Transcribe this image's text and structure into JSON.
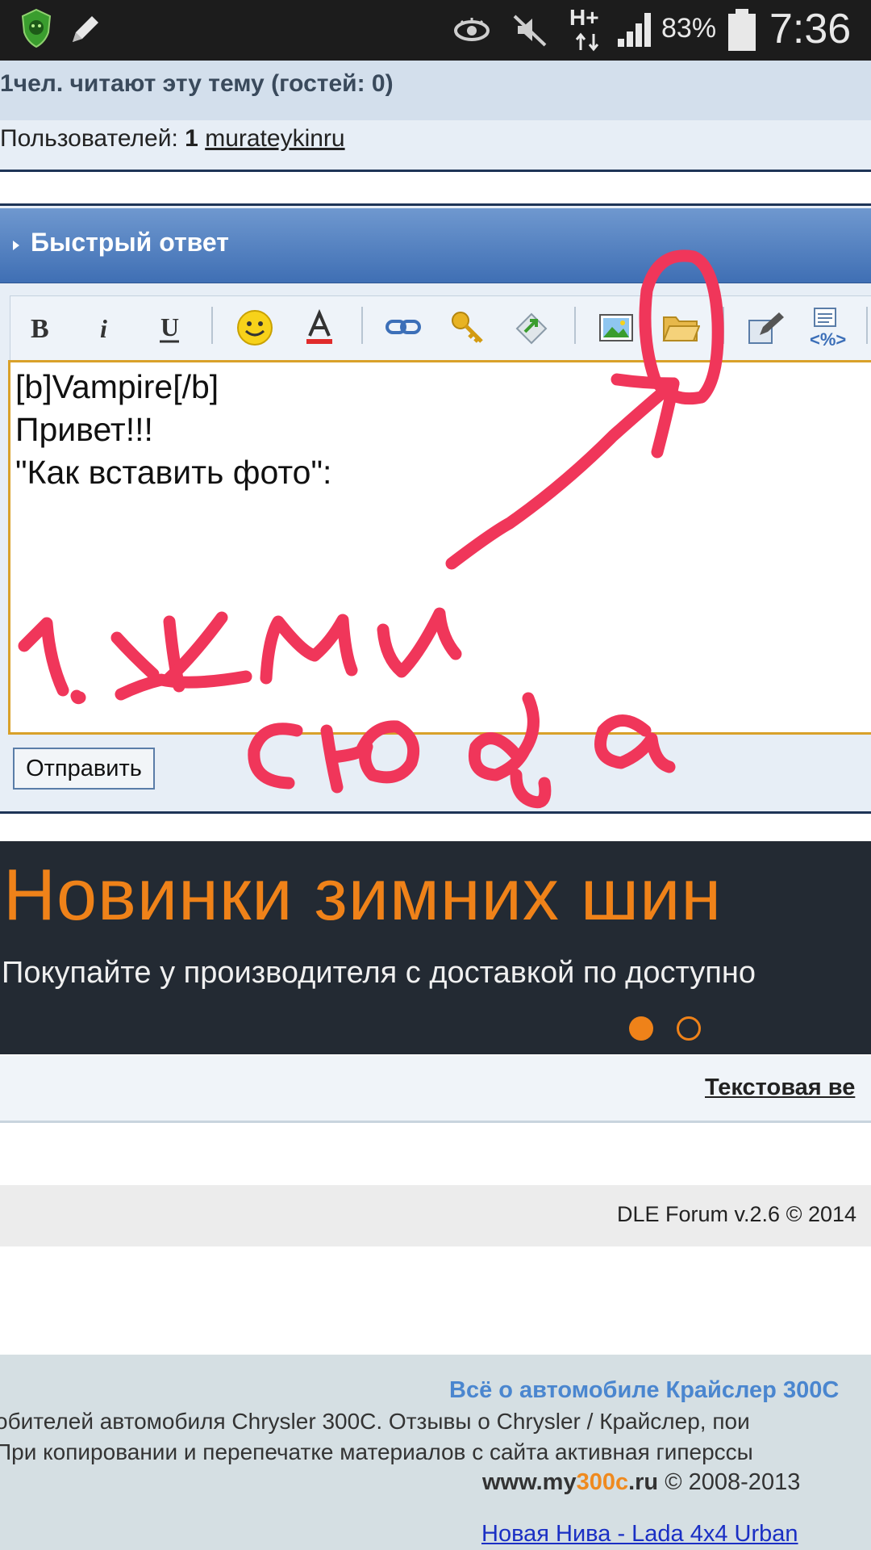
{
  "status_bar": {
    "battery": "83%",
    "time": "7:36",
    "network": "H+"
  },
  "readers": {
    "title": "1чел. читают эту тему (гостей: 0)",
    "users_label": "Пользователей:",
    "users_count": "1",
    "user_name": "murateykinru"
  },
  "quick_reply": {
    "title": "Быстрый ответ",
    "toolbar": [
      "bold",
      "italic",
      "underline",
      "smiley",
      "text-color",
      "link",
      "key",
      "image-arrow",
      "picture",
      "folder",
      "edit",
      "code"
    ],
    "editor_text": "[b]Vampire[/b]\nПривет!!!\n\"Как вставить фото\":",
    "send_label": "Отправить"
  },
  "banner": {
    "title": "Новинки зимних шин ",
    "subtitle": "Покупайте у производителя с доставкой по доступно",
    "dots": [
      "active",
      "inactive"
    ],
    "accent_color": "#ef8219"
  },
  "text_version": "Текстовая ве",
  "copyright": "DLE Forum v.2.6 © 2014",
  "footer": {
    "title": "Всё о автомобиле Крайслер 300С",
    "line1": "обителей автомобиля Chrysler 300C. Отзывы о Chrysler / Крайслер, пои",
    "line2": "При копировании и перепечатке материалов с сайта активная гиперссы",
    "site_prefix": "www.my",
    "site_accent": "300c",
    "site_suffix": ".ru",
    "site_years": " © 2008-2013",
    "link": "Новая Нива - Lada 4x4 Urban"
  },
  "annotation": {
    "line1": "1.ЖМИ",
    "line2": "сюда",
    "color": "#f0365a"
  }
}
